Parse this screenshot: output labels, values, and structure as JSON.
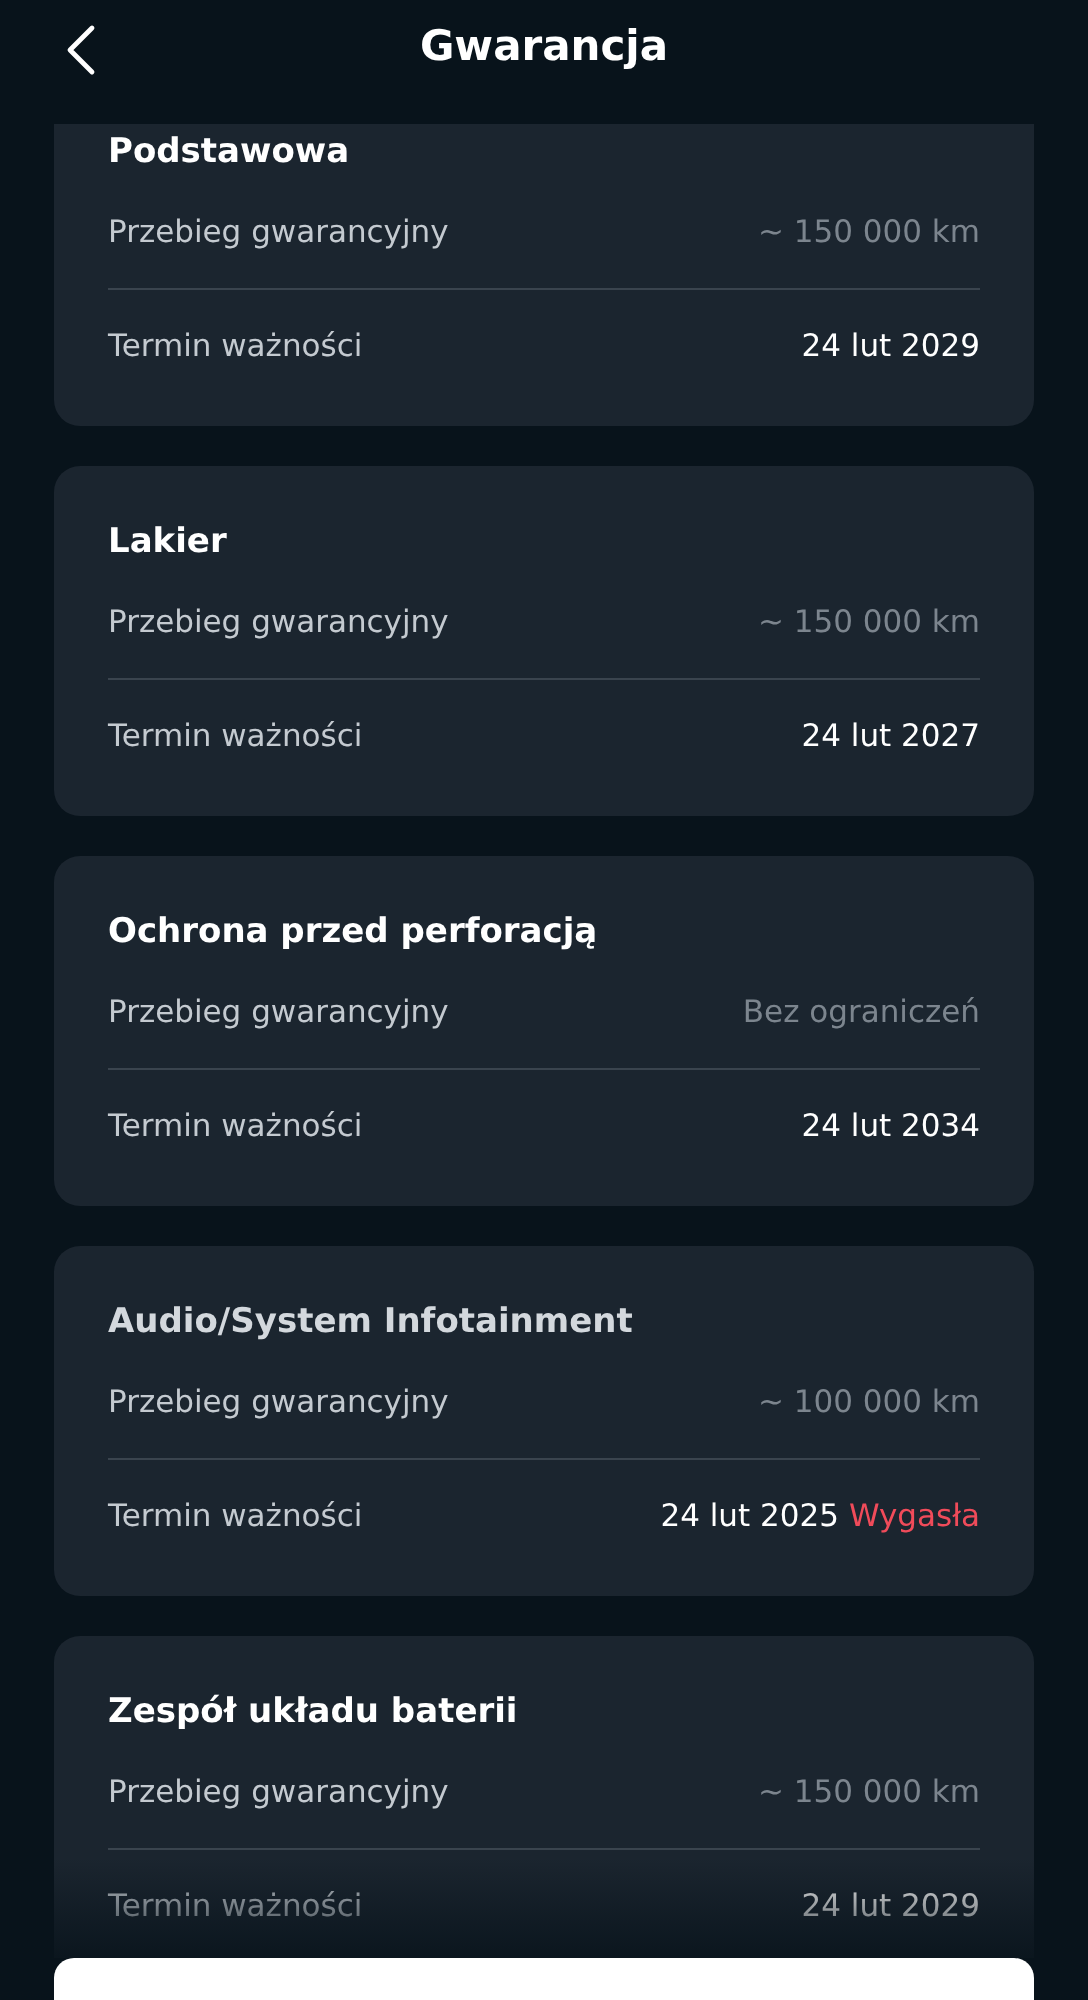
{
  "header": {
    "title": "Gwarancja"
  },
  "cards": [
    {
      "title": "Podstawowa",
      "expired": false,
      "rows": [
        {
          "kind": "mileage",
          "label": "Przebieg gwarancyjny",
          "value": "~ 150 000 km"
        },
        {
          "kind": "date",
          "label": "Termin ważności",
          "value": "24 lut 2029"
        }
      ]
    },
    {
      "title": "Lakier",
      "expired": false,
      "rows": [
        {
          "kind": "mileage",
          "label": "Przebieg gwarancyjny",
          "value": "~ 150 000 km"
        },
        {
          "kind": "date",
          "label": "Termin ważności",
          "value": "24 lut 2027"
        }
      ]
    },
    {
      "title": "Ochrona przed perforacją",
      "expired": false,
      "rows": [
        {
          "kind": "mileage",
          "label": "Przebieg gwarancyjny",
          "value": "Bez ograniczeń"
        },
        {
          "kind": "date",
          "label": "Termin ważności",
          "value": "24 lut 2034"
        }
      ]
    },
    {
      "title": "Audio/System Infotainment",
      "expired": true,
      "rows": [
        {
          "kind": "mileage",
          "label": "Przebieg gwarancyjny",
          "value": "~ 100 000 km"
        },
        {
          "kind": "date",
          "label": "Termin ważności",
          "value": "24 lut 2025",
          "status": "Wygasła"
        }
      ]
    },
    {
      "title": "Zespół układu baterii",
      "expired": false,
      "rows": [
        {
          "kind": "mileage",
          "label": "Przebieg gwarancyjny",
          "value": "~ 150 000 km"
        },
        {
          "kind": "date",
          "label": "Termin ważności",
          "value": "24 lut 2029"
        }
      ]
    }
  ]
}
